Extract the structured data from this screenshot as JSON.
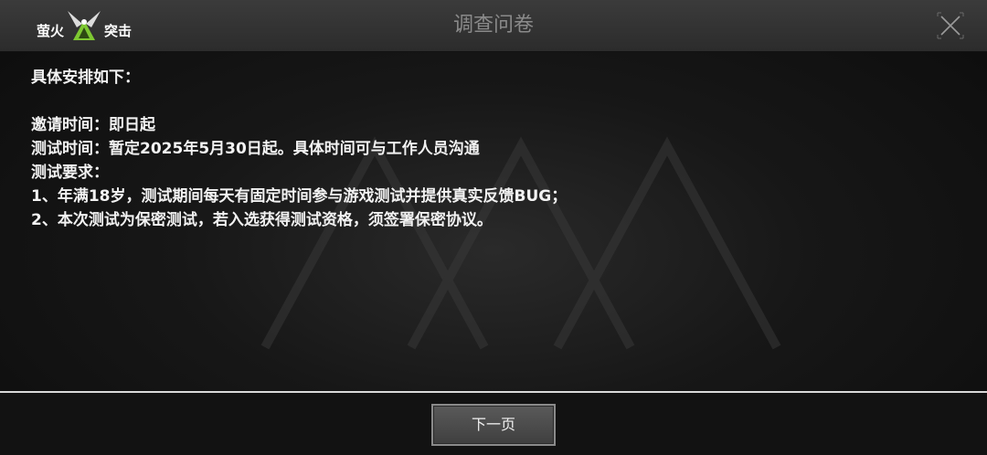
{
  "header": {
    "logo_left": "萤火",
    "logo_right": "突击",
    "title": "调查问卷",
    "close_icon": "close-icon"
  },
  "content": {
    "heading": "具体安排如下：",
    "lines": [
      "邀请时间：即日起",
      "测试时间：暂定2025年5月30日起。具体时间可与工作人员沟通",
      "测试要求：",
      "1、年满18岁，测试期间每天有固定时间参与游戏测试并提供真实反馈BUG；",
      "2、本次测试为保密测试，若入选获得测试资格，须签署保密协议。"
    ]
  },
  "footer": {
    "next_label": "下一页"
  },
  "colors": {
    "titlebar": "#333333",
    "text": "#f2f2f2",
    "title_text": "#8a8a8a",
    "logo_green": "#7ec832"
  }
}
